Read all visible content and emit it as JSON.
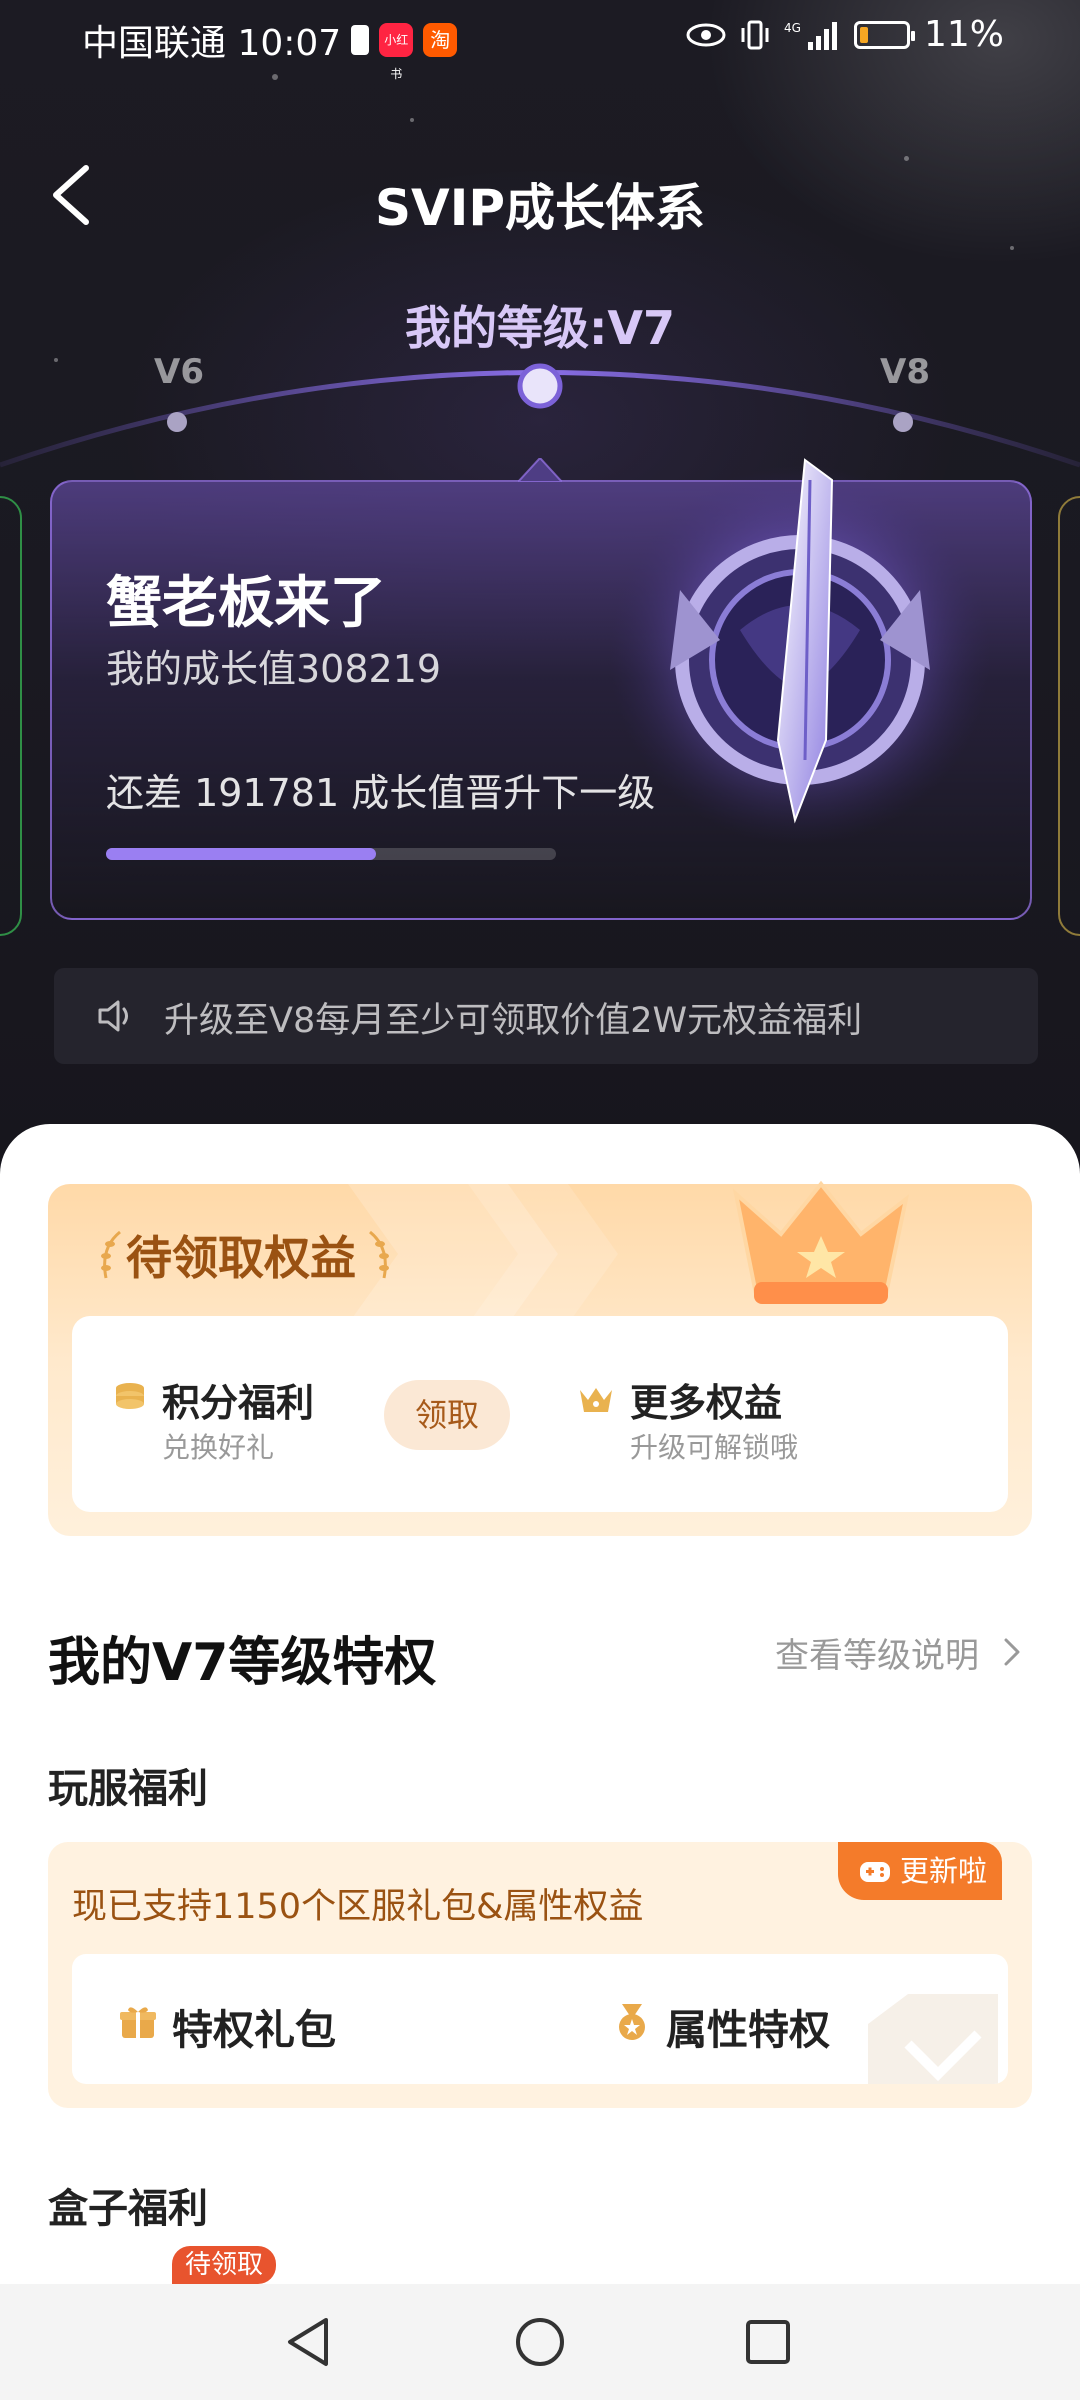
{
  "status_bar": {
    "carrier_time": "中国联通 10:07",
    "app_badges": [
      "小红书",
      "淘"
    ],
    "battery": "11%",
    "signal": "4G"
  },
  "header": {
    "title": "SVIP成长体系",
    "back_icon": "chevron-left-icon"
  },
  "level": {
    "my_level": "我的等级:V7",
    "prev": "V6",
    "next": "V8"
  },
  "growth_card": {
    "name": "蟹老板来了",
    "growth_value": "我的成长值308219",
    "diff_text": "还差 191781 成长值晋升下一级",
    "progress": 0.6
  },
  "notice": {
    "text": "升级至V8每月至少可领取价值2W元权益福利"
  },
  "rights": {
    "title": "待领取权益",
    "items": [
      {
        "title": "积分福利",
        "sub": "兑换好礼",
        "icon": "coins-icon"
      },
      {
        "title": "更多权益",
        "sub": "升级可解锁哦",
        "icon": "crown-icon"
      }
    ],
    "claim_label": "领取"
  },
  "privilege": {
    "title": "我的V7等级特权",
    "link": "查看等级说明"
  },
  "server_welfare": {
    "title": "玩服福利",
    "text": "现已支持1150个区服礼包&属性权益",
    "badge": "更新啦",
    "items": [
      "特权礼包",
      "属性特权"
    ]
  },
  "box_welfare": {
    "title": "盒子福利",
    "badge": "待领取"
  },
  "colors": {
    "accent_purple": "#9a7ff2",
    "gold_text": "#9a5212",
    "orange_badge": "#f47b2a"
  }
}
